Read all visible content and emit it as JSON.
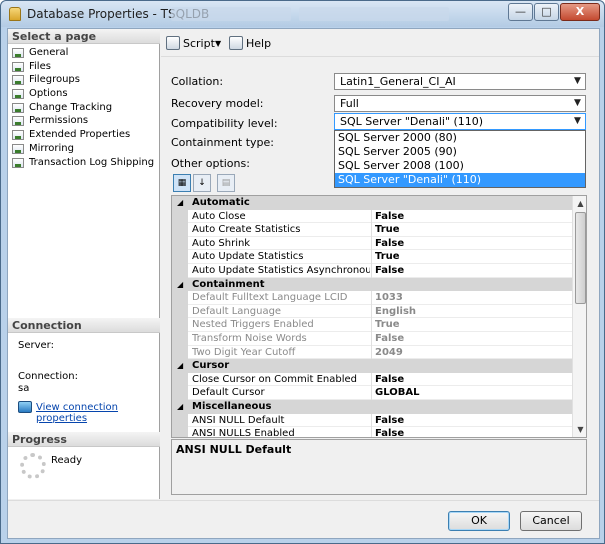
{
  "window": {
    "title": "Database Properties - TSQLDB",
    "controls": {
      "minimize": "—",
      "maximize": "□",
      "close": "X"
    }
  },
  "sidebar": {
    "select_page_header": "Select a page",
    "pages": [
      "General",
      "Files",
      "Filegroups",
      "Options",
      "Change Tracking",
      "Permissions",
      "Extended Properties",
      "Mirroring",
      "Transaction Log Shipping"
    ],
    "connection_header": "Connection",
    "server_label": "Server:",
    "connection_label": "Connection:",
    "connection_value": "sa",
    "view_connection_properties": "View connection properties",
    "progress_header": "Progress",
    "progress_status": "Ready"
  },
  "toolbar": {
    "script_label": "Script",
    "help_label": "Help"
  },
  "form": {
    "collation_label": "Collation:",
    "collation_value": "Latin1_General_CI_AI",
    "recovery_label": "Recovery model:",
    "recovery_value": "Full",
    "compat_label": "Compatibility level:",
    "compat_value": "SQL Server \"Denali\" (110)",
    "containment_label": "Containment type:",
    "other_options_label": "Other options:"
  },
  "compat_options": [
    "SQL Server 2000 (80)",
    "SQL Server 2005 (90)",
    "SQL Server 2008 (100)",
    "SQL Server \"Denali\" (110)"
  ],
  "grid": [
    {
      "type": "category",
      "name": "Automatic"
    },
    {
      "type": "prop",
      "name": "Auto Close",
      "value": "False"
    },
    {
      "type": "prop",
      "name": "Auto Create Statistics",
      "value": "True"
    },
    {
      "type": "prop",
      "name": "Auto Shrink",
      "value": "False"
    },
    {
      "type": "prop",
      "name": "Auto Update Statistics",
      "value": "True"
    },
    {
      "type": "prop",
      "name": "Auto Update Statistics Asynchronously",
      "value": "False"
    },
    {
      "type": "category",
      "name": "Containment"
    },
    {
      "type": "prop",
      "name": "Default Fulltext Language LCID",
      "value": "1033",
      "disabled": true
    },
    {
      "type": "prop",
      "name": "Default Language",
      "value": "English",
      "disabled": true
    },
    {
      "type": "prop",
      "name": "Nested Triggers Enabled",
      "value": "True",
      "disabled": true
    },
    {
      "type": "prop",
      "name": "Transform Noise Words",
      "value": "False",
      "disabled": true
    },
    {
      "type": "prop",
      "name": "Two Digit Year Cutoff",
      "value": "2049",
      "disabled": true
    },
    {
      "type": "category",
      "name": "Cursor"
    },
    {
      "type": "prop",
      "name": "Close Cursor on Commit Enabled",
      "value": "False"
    },
    {
      "type": "prop",
      "name": "Default Cursor",
      "value": "GLOBAL"
    },
    {
      "type": "category",
      "name": "Miscellaneous"
    },
    {
      "type": "prop",
      "name": "ANSI NULL Default",
      "value": "False"
    },
    {
      "type": "prop",
      "name": "ANSI NULLS Enabled",
      "value": "False"
    }
  ],
  "description": {
    "title": "ANSI NULL Default"
  },
  "footer": {
    "ok_label": "OK",
    "cancel_label": "Cancel"
  }
}
